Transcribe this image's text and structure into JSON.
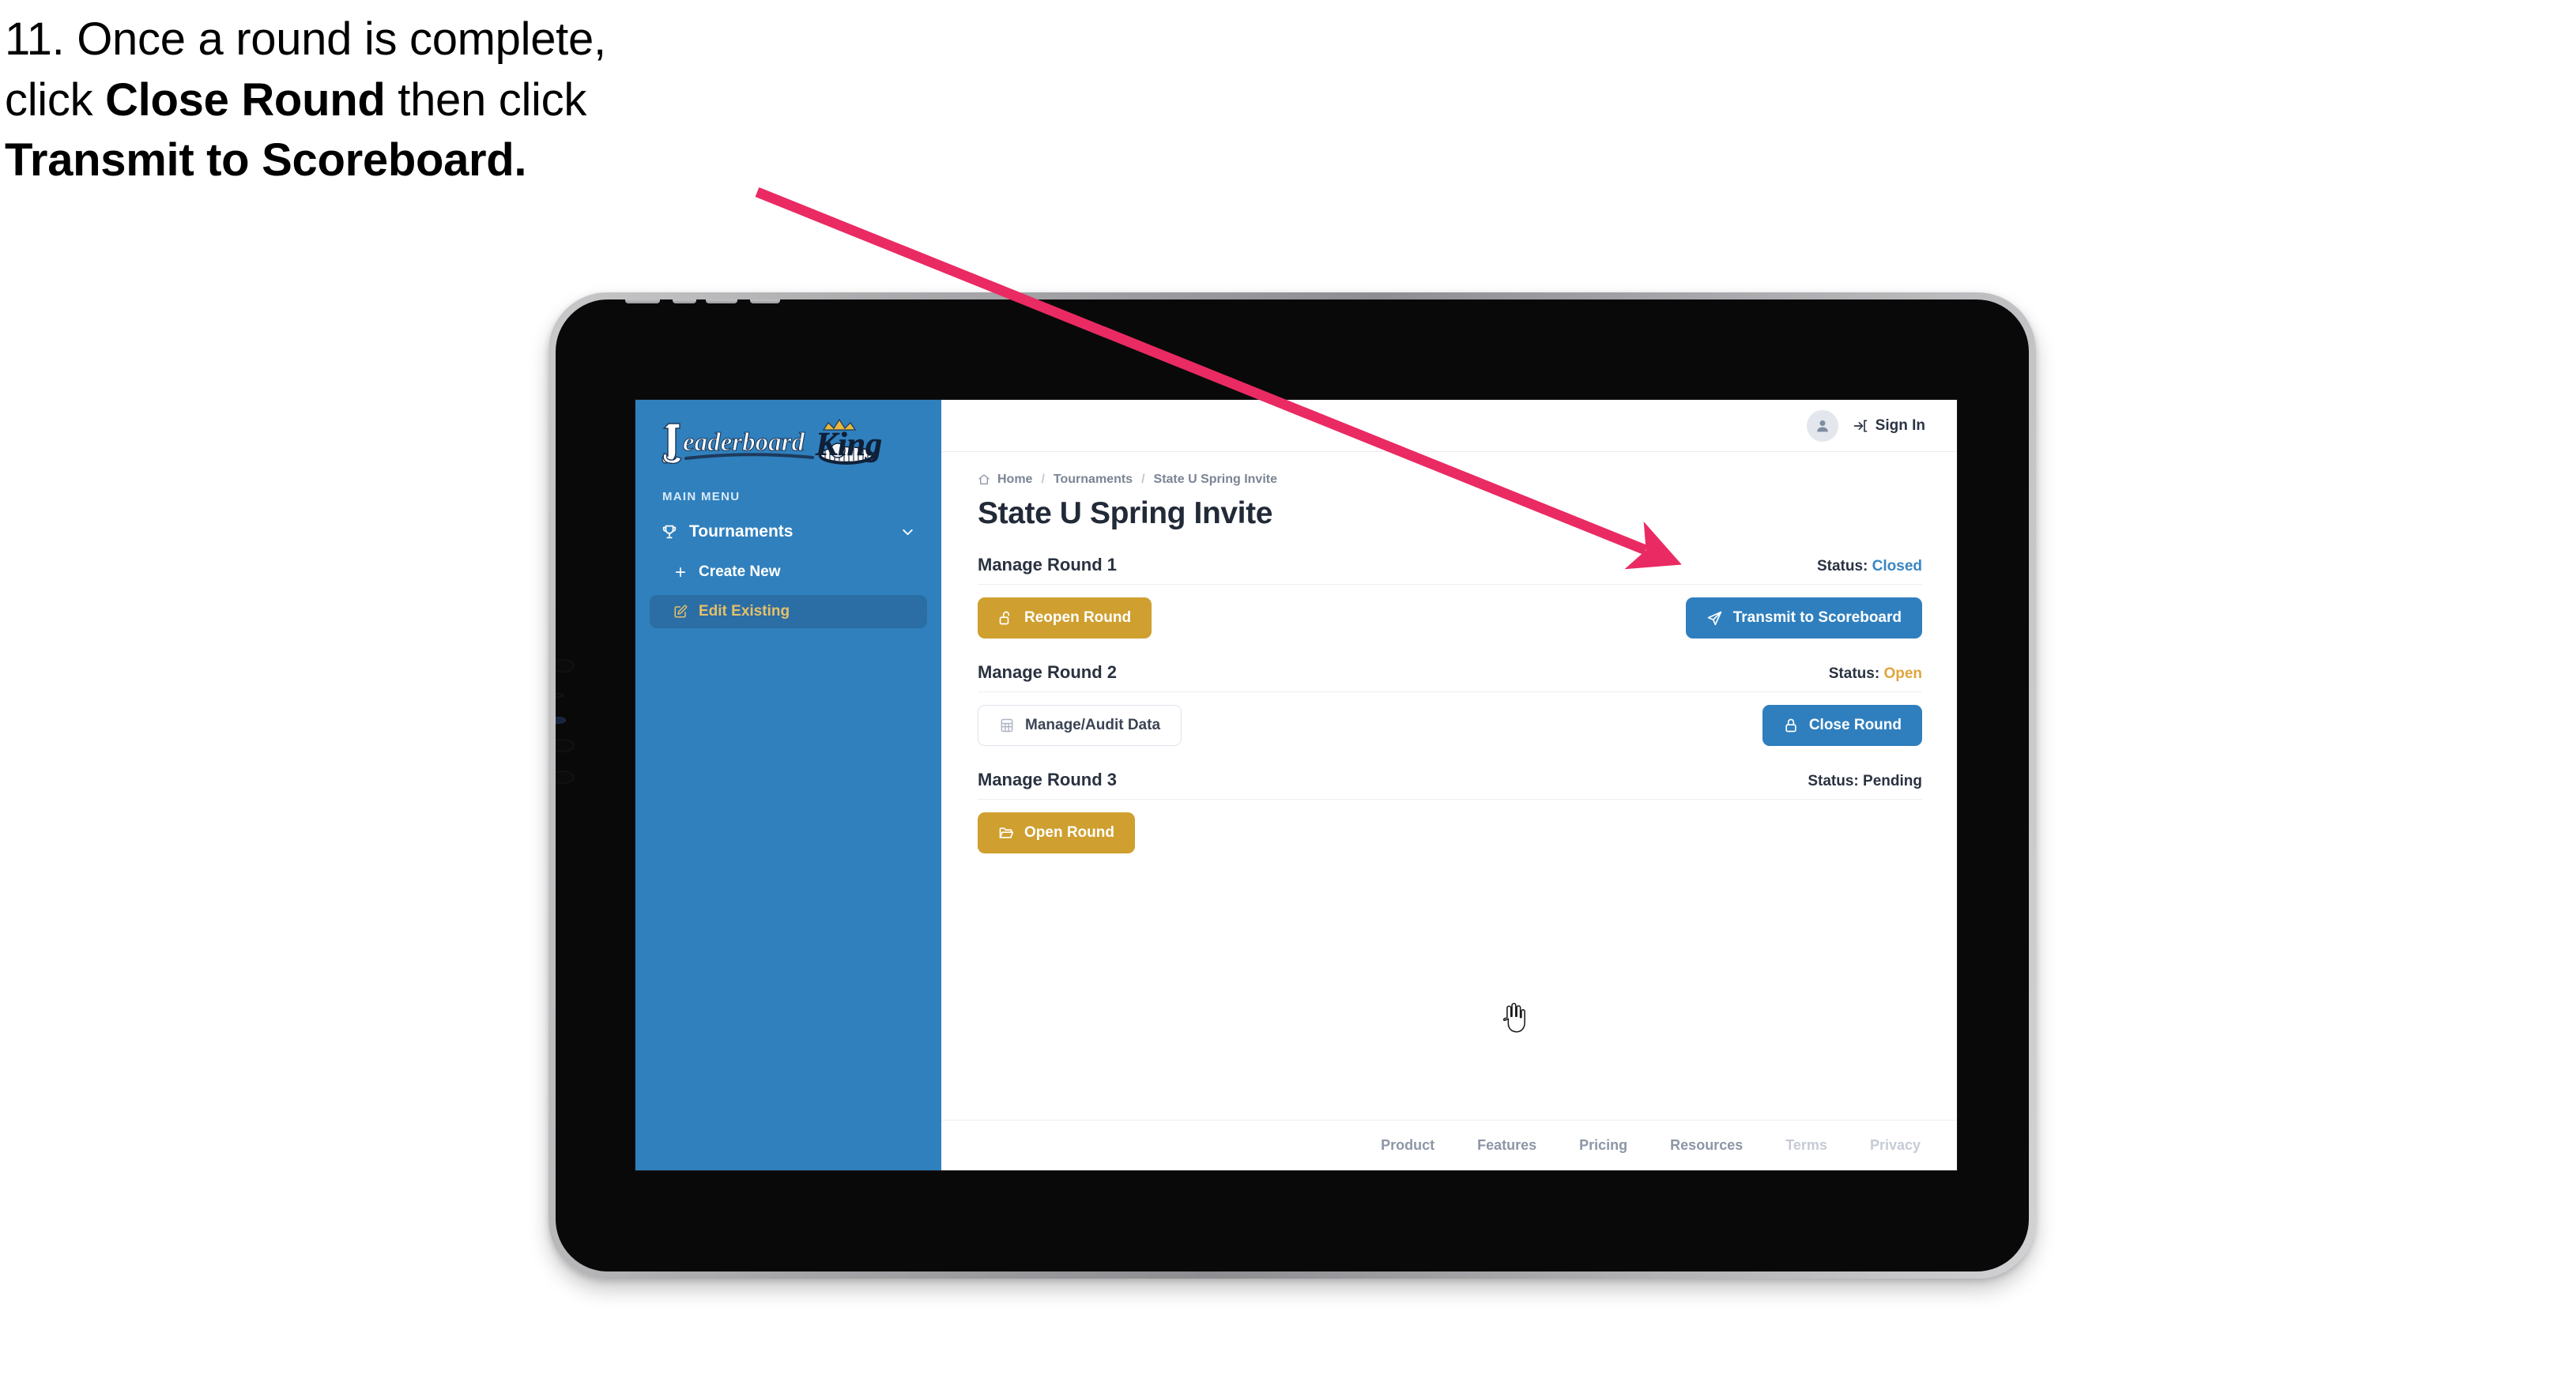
{
  "caption": {
    "line1": "11. Once a round is complete,",
    "line2_pre": "click ",
    "line2_bold": "Close Round",
    "line2_post": " then click",
    "line3_bold": "Transmit to Scoreboard."
  },
  "annotation": {
    "arrow_color": "#ea2a63",
    "arrow_name": "pointer-arrow-to-transmit-button"
  },
  "app": {
    "sidebar": {
      "logo_primary": "Leaderboard",
      "logo_secondary": "King",
      "menu_label": "MAIN MENU",
      "items": [
        {
          "label": "Tournaments",
          "icon": "trophy-icon",
          "chevron": "chevron-down-icon",
          "active": false
        },
        {
          "label": "Create New",
          "icon": "plus-icon",
          "active": false
        },
        {
          "label": "Edit Existing",
          "icon": "edit-pencil-icon",
          "active": true
        }
      ],
      "bg_color": "#3080bd",
      "active_bg": "#2a6ea5",
      "active_text": "#e5c06a"
    },
    "topbar": {
      "avatar_icon": "user-avatar-icon",
      "signin_icon": "sign-in-arrow-icon",
      "signin_label": "Sign In"
    },
    "breadcrumb": {
      "home_icon": "home-icon",
      "items": [
        "Home",
        "Tournaments",
        "State U Spring Invite"
      ],
      "separator": "/"
    },
    "page_title": "State U Spring Invite",
    "rounds": [
      {
        "name": "Manage Round 1",
        "status_label": "Status:",
        "status_value": "Closed",
        "status_kind": "closed",
        "left_button": {
          "label": "Reopen Round",
          "icon": "unlock-icon",
          "style": "gold"
        },
        "right_button": {
          "label": "Transmit to Scoreboard",
          "icon": "paper-plane-icon",
          "style": "blue"
        }
      },
      {
        "name": "Manage Round 2",
        "status_label": "Status:",
        "status_value": "Open",
        "status_kind": "open",
        "left_button": {
          "label": "Manage/Audit Data",
          "icon": "grid-table-icon",
          "style": "ghost"
        },
        "right_button": {
          "label": "Close Round",
          "icon": "lock-icon",
          "style": "blue"
        }
      },
      {
        "name": "Manage Round 3",
        "status_label": "Status:",
        "status_value": "Pending",
        "status_kind": "pending",
        "left_button": {
          "label": "Open Round",
          "icon": "folder-open-icon",
          "style": "gold"
        },
        "right_button": null
      }
    ],
    "footer": {
      "links": [
        "Product",
        "Features",
        "Pricing",
        "Resources",
        "Terms",
        "Privacy"
      ],
      "dim_from_index": 4
    },
    "colors": {
      "gold": "#cf9f2f",
      "blue": "#2f7fbe",
      "status_closed": "#3886c4",
      "status_open": "#e0a53b",
      "title": "#222a38"
    }
  },
  "cursor": {
    "type": "pointer-hand-cursor"
  }
}
